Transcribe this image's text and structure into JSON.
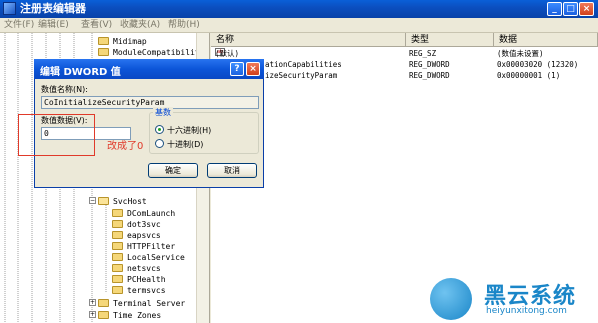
{
  "window": {
    "title": "注册表编辑器",
    "min": "_",
    "max": "□",
    "close": "×"
  },
  "menu": [
    "文件(F)",
    "编辑(E)",
    "查看(V)",
    "收藏夹(A)",
    "帮助(H)"
  ],
  "tree": {
    "top_items": [
      "Midimap",
      "ModuleCompatibility"
    ],
    "svchost": "SvcHost",
    "svchost_children": [
      "DComLaunch",
      "dot3svc",
      "eapsvcs",
      "HTTPFilter",
      "LocalService",
      "netsvcs",
      "PCHealth",
      "termsvcs"
    ],
    "bottom_items": [
      "Terminal Server",
      "Time Zones"
    ]
  },
  "list": {
    "headers": [
      "名称",
      "类型",
      "数据"
    ],
    "rows": [
      {
        "name": "(默认)",
        "type": "REG_SZ",
        "data": "(数值未设置)"
      },
      {
        "name": "ationCapabilities",
        "type": "REG_DWORD",
        "data": "0x00003020 (12320)"
      },
      {
        "name": "izeSecurityParam",
        "type": "REG_DWORD",
        "data": "0x00000001 (1)"
      }
    ],
    "icon_sz": "ab"
  },
  "dialog": {
    "title": "编辑 DWORD 值",
    "help": "?",
    "close": "×",
    "name_label": "数值名称(N):",
    "name_value": "CoInitializeSecurityParam",
    "data_label": "数值数据(V):",
    "data_value": "0",
    "base_label": "基数",
    "hex_label": "十六进制(H)",
    "dec_label": "十进制(D)",
    "ok": "确定",
    "cancel": "取消"
  },
  "annotation": "改成了0",
  "watermark": {
    "brand": "黑云系统",
    "url": "heiyunxitong.com"
  },
  "colors": {
    "titlebar": "#0b4fc0",
    "annotation": "#e03a2a",
    "watermark": "#1a86c8"
  }
}
